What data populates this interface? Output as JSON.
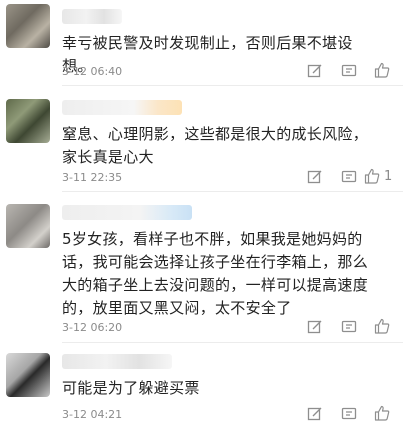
{
  "comments": [
    {
      "text": "幸亏被民警及时发现制止，否则后果不堪设想。",
      "time": "3-12 06:40",
      "likes": ""
    },
    {
      "text": "窒息、心理阴影，这些都是很大的成长风险，家长真是心大",
      "time": "3-11 22:35",
      "likes": "1"
    },
    {
      "text": "5岁女孩，看样子也不胖，如果我是她妈妈的话，我可能会选择让孩子坐在行李箱上，那么大的箱子坐上去没问题的，一样可以提高速度的，放里面又黑又闷，太不安全了",
      "time": "3-12 06:20",
      "likes": ""
    },
    {
      "text": "可能是为了躲避买票",
      "time": "3-12 04:21",
      "likes": ""
    }
  ],
  "icons": [
    "edit-icon",
    "comment-icon",
    "like-icon"
  ]
}
